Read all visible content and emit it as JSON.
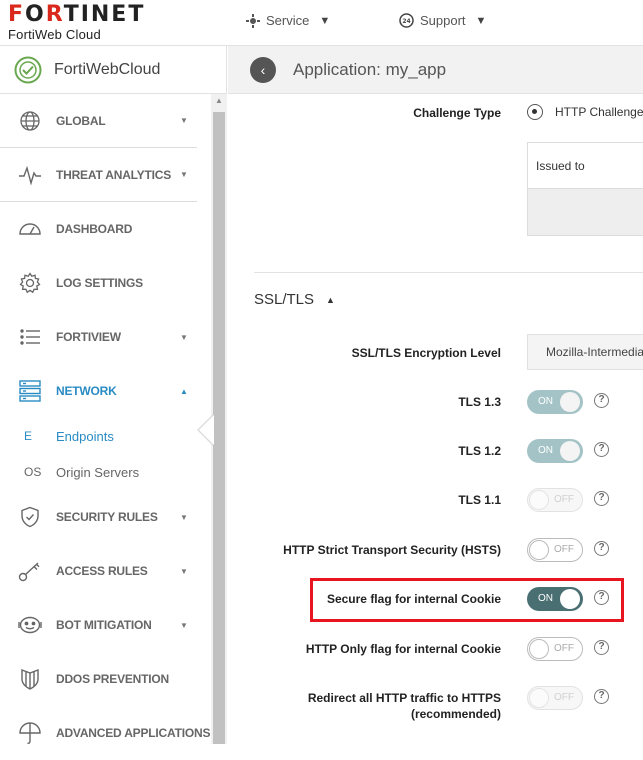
{
  "topbar": {
    "logo_text": "FORTINET",
    "product": "FortiWeb Cloud",
    "service_label": "Service",
    "support_label": "Support"
  },
  "sidebar": {
    "brand": "FortiWebCloud",
    "items": [
      {
        "label": "GLOBAL",
        "icon": "globe-icon"
      },
      {
        "label": "THREAT ANALYTICS",
        "icon": "pulse-icon"
      },
      {
        "label": "DASHBOARD",
        "icon": "gauge-icon"
      },
      {
        "label": "LOG SETTINGS",
        "icon": "gear-icon"
      },
      {
        "label": "FORTIVIEW",
        "icon": "list-icon"
      },
      {
        "label": "NETWORK",
        "icon": "network-icon"
      },
      {
        "label": "SECURITY RULES",
        "icon": "shield-icon"
      },
      {
        "label": "ACCESS RULES",
        "icon": "key-icon"
      },
      {
        "label": "BOT MITIGATION",
        "icon": "bot-icon"
      },
      {
        "label": "DDOS PREVENTION",
        "icon": "ddos-shield-icon"
      },
      {
        "label": "ADVANCED APPLICATIONS",
        "icon": "umbrella-icon"
      }
    ],
    "sub_items": [
      {
        "prefix": "E",
        "label": "Endpoints"
      },
      {
        "prefix": "OS",
        "label": "Origin Servers"
      }
    ]
  },
  "header": {
    "title": "Application: my_app"
  },
  "main": {
    "challenge_type_label": "Challenge Type",
    "challenge_option": "HTTP Challenge",
    "issued_to_label": "Issued to",
    "ssl_section": "SSL/TLS",
    "encryption_label": "SSL/TLS Encryption Level",
    "encryption_value": "Mozilla-Intermedia",
    "tls13_label": "TLS 1.3",
    "tls12_label": "TLS 1.2",
    "tls11_label": "TLS 1.1",
    "hsts_label": "HTTP Strict Transport Security (HSTS)",
    "secure_flag_label": "Secure flag for internal Cookie",
    "http_only_label": "HTTP Only flag for internal Cookie",
    "redirect_label_1": "Redirect all HTTP traffic to HTTPS",
    "redirect_label_2": "(recommended)",
    "on_text": "ON",
    "off_text": "OFF",
    "help_glyph": "?"
  },
  "colors": {
    "accent": "#2a8bc4",
    "brand_red": "#da291c",
    "toggle_on": "#4a6f73",
    "highlight": "#e8141e"
  }
}
